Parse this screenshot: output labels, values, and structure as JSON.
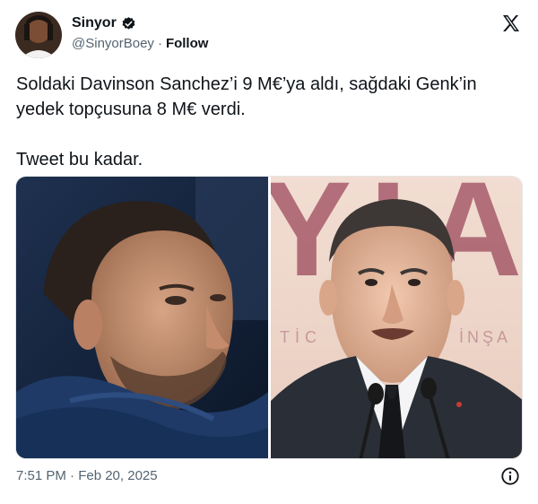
{
  "author": {
    "display_name": "Sinyor",
    "handle": "@SinyorBoey",
    "separator": "·",
    "follow_label": "Follow",
    "verified": true
  },
  "tweet": {
    "text": "Soldaki Davinson Sanchez’i 9 M€’ya aldı, sağdaki Genk’in yedek topçusuna 8 M€ verdi.\n\nTweet bu kadar.",
    "timestamp": "7:51 PM · Feb 20, 2025"
  },
  "media": {
    "right_photo_background_text": "YIA",
    "right_photo_banner_text_left": "TİC",
    "right_photo_banner_text_right": "İNŞA"
  },
  "icons": {
    "verified": "verified-badge-icon",
    "platform": "x-logo-icon",
    "info": "info-icon"
  },
  "colors": {
    "text_primary": "#0f1419",
    "text_secondary": "#536471",
    "verified_badge": "#1d9bf0"
  }
}
